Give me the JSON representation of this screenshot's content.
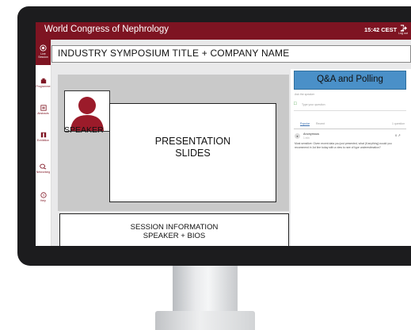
{
  "header": {
    "app_title": "World Congress of Nephrology",
    "time": "15:42 CEST",
    "logout_label": "Log out"
  },
  "sidebar": {
    "items": [
      {
        "label": "Live Session"
      },
      {
        "label": "Programme"
      },
      {
        "label": "Abstracts"
      },
      {
        "label": "Exhibition"
      },
      {
        "label": "Networking"
      },
      {
        "label": "Help"
      }
    ]
  },
  "session": {
    "title": "INDUSTRY SYMPOSIUM TITLE + COMPANY NAME"
  },
  "player": {
    "speaker_label": "SPEAKER",
    "slides_line1": "PRESENTATION",
    "slides_line2": "SLIDES"
  },
  "info": {
    "line1": "SESSION INFORMATION",
    "line2": "SPEAKER + BIOS"
  },
  "qa": {
    "title": "Q&A and Polling",
    "section_label": "Ask the speaker",
    "input_placeholder": "Type your question",
    "tabs": [
      {
        "label": "Popular"
      },
      {
        "label": "Recent"
      }
    ],
    "count": "1 question",
    "question": {
      "author": "Anonymous",
      "time": "1 min",
      "votes": "0",
      "text": "Most sensitive: Given recent data you just presented, what (if anything) would you recommend in 1st line today with a view to rare of type underestimation?"
    }
  },
  "colors": {
    "brand": "#7e1422",
    "qa_header": "#4a90c8",
    "player_bg": "#c9c9c9"
  }
}
